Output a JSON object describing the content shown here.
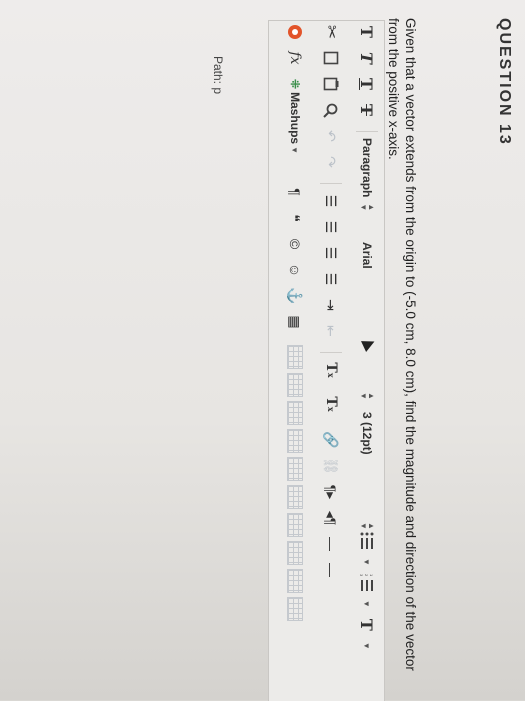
{
  "question": {
    "title": "QUESTION 13",
    "text": "Given that a vector extends from the origin to (-5.0 cm, 8.0 cm), find the magnitude and direction of the vector from the positive x-axis."
  },
  "toolbar": {
    "format_labels": [
      "T",
      "T",
      "T",
      "T"
    ],
    "paragraph_label": "Paragraph",
    "font_label": "Arial",
    "size_label": "3 (12pt)",
    "mashups_label": "Mashups",
    "fx_label": "fx",
    "superscript_label": "T",
    "subscript_label": "T"
  },
  "footer": {
    "path_label": "Path: p"
  }
}
